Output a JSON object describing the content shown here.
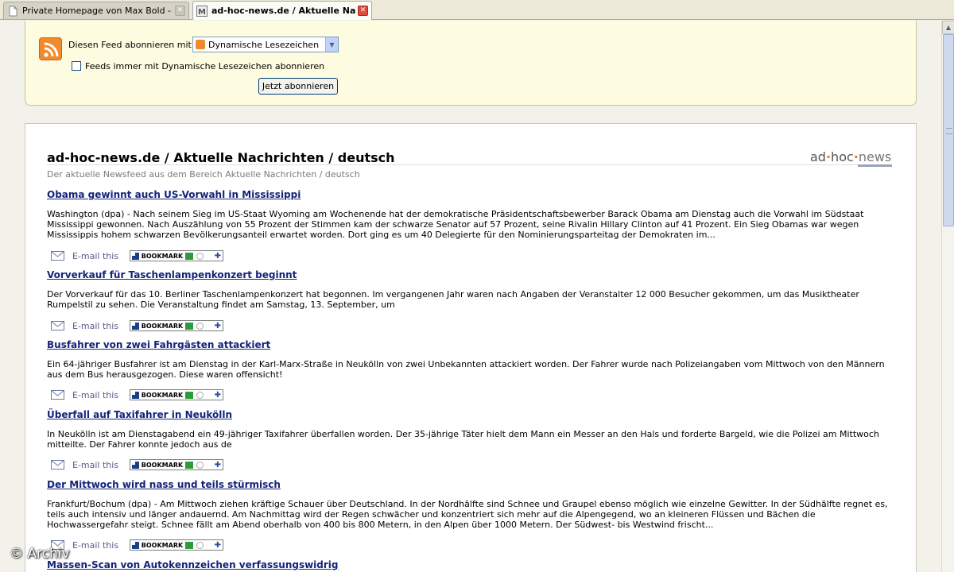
{
  "tabs": [
    {
      "label": "Private Homepage von Max Bold - Übe...",
      "active": false
    },
    {
      "label": "ad-hoc-news.de / Aktuelle Nachri...",
      "active": true
    }
  ],
  "subscribe": {
    "label": "Diesen Feed abonnieren mit",
    "select_value": "Dynamische Lesezeichen",
    "checkbox_label": "Feeds immer mit Dynamische Lesezeichen abonnieren",
    "button_label": "Jetzt abonnieren"
  },
  "feed": {
    "title": "ad-hoc-news.de / Aktuelle Nachrichten / deutsch",
    "subtitle": "Der aktuelle Newsfeed aus dem Bereich Aktuelle Nachrichten / deutsch",
    "logo": {
      "part1": "ad",
      "dot1": "·",
      "part2": "hoc",
      "dot2": "·",
      "part3": "news"
    },
    "mail_label": "E-mail this",
    "bookmark_label": "BOOKMARK",
    "items": [
      {
        "title": "Obama gewinnt auch US-Vorwahl in Mississippi",
        "body": "Washington (dpa) - Nach seinem Sieg im US-Staat Wyoming am Wochenende hat der demokratische Präsidentschaftsbewerber Barack Obama am Dienstag auch die Vorwahl im Südstaat Mississippi gewonnen. Nach Auszählung von 55 Prozent der Stimmen kam der schwarze Senator auf 57 Prozent, seine Rivalin Hillary Clinton auf 41 Prozent. Ein Sieg Obamas war wegen Mississippis hohem schwarzen Bevölkerungsanteil erwartet worden. Dort ging es um 40 Delegierte für den Nominierungsparteitag der Demokraten im..."
      },
      {
        "title": "Vorverkauf für Taschenlampenkonzert beginnt",
        "body": "Der Vorverkauf für das 10. Berliner Taschenlampenkonzert hat begonnen. Im vergangenen Jahr waren nach Angaben der Veranstalter 12 000 Besucher gekommen, um das Musiktheater Rumpelstil zu sehen. Die Veranstaltung findet am Samstag, 13. September, um"
      },
      {
        "title": "Busfahrer von zwei Fahrgästen attackiert",
        "body": "Ein 64-jähriger Busfahrer ist am Dienstag in der Karl-Marx-Straße in Neukölln von zwei Unbekannten attackiert worden. Der Fahrer wurde nach Polizeiangaben vom Mittwoch von den Männern aus dem Bus herausgezogen. Diese waren offensicht!"
      },
      {
        "title": "Überfall auf Taxifahrer in Neukölln",
        "body": "In Neukölln ist am Dienstagabend ein 49-jähriger Taxifahrer überfallen worden. Der 35-jährige Täter hielt dem Mann ein Messer an den Hals und forderte Bargeld, wie die Polizei am Mittwoch mitteilte. Der Fahrer konnte jedoch aus de"
      },
      {
        "title": "Der Mittwoch wird nass und teils stürmisch",
        "body": "Frankfurt/Bochum (dpa) - Am Mittwoch ziehen kräftige Schauer über Deutschland. In der Nordhälfte sind Schnee und Graupel ebenso möglich wie einzelne Gewitter. In der Südhälfte regnet es, teils auch intensiv und länger andauernd. Am Nachmittag wird der Regen schwächer und konzentriert sich mehr auf die Alpengegend, wo an kleineren Flüssen und Bächen die Hochwassergefahr steigt. Schnee fällt am Abend oberhalb von 400 bis 800 Metern, in den Alpen über 1000 Metern. Der Südwest- bis Westwind frischt..."
      },
      {
        "title": "Massen-Scan von Autokennzeichen verfassungswidrig",
        "body": ""
      }
    ]
  },
  "watermark": "© Archiv",
  "colors": {
    "link": "#13237b",
    "subscribe_bg": "#fdfce0",
    "rss_orange": "#f18a2b"
  }
}
